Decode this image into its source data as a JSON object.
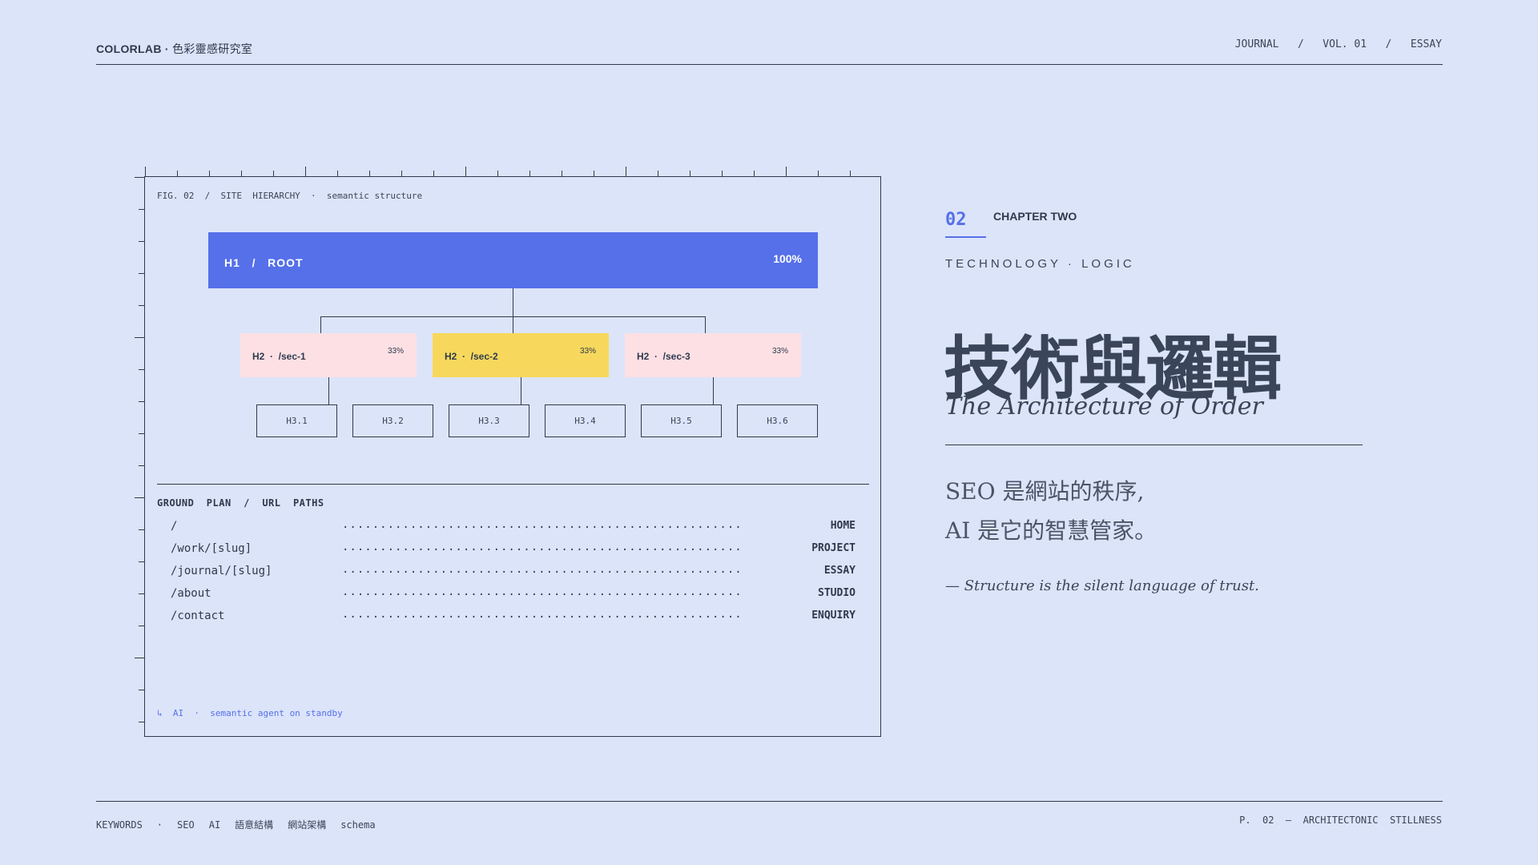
{
  "header": {
    "brand": "COLORLAB",
    "brand_sep": " · ",
    "brand_sub": "色彩靈感研究室",
    "meta": "JOURNAL   /   VOL. 01   /   ESSAY"
  },
  "figure": {
    "caption": "FIG. 02  /  SITE  HIERARCHY  ·  semantic structure",
    "h1": {
      "label": "H1   /   ROOT",
      "pct": "100%"
    },
    "h2": [
      {
        "label": "H2  ·  /sec-1",
        "pct": "33%",
        "color": "#fde0e4"
      },
      {
        "label": "H2  ·  /sec-2",
        "pct": "33%",
        "color": "#f7d85c"
      },
      {
        "label": "H2  ·  /sec-3",
        "pct": "33%",
        "color": "#fde0e4"
      }
    ],
    "h3": [
      "H3.1",
      "H3.2",
      "H3.3",
      "H3.4",
      "H3.5",
      "H3.6"
    ],
    "plan_title": "GROUND  PLAN  /  URL  PATHS",
    "paths": [
      {
        "path": "/",
        "dest": "HOME"
      },
      {
        "path": "/work/[slug]",
        "dest": "PROJECT"
      },
      {
        "path": "/journal/[slug]",
        "dest": "ESSAY"
      },
      {
        "path": "/about",
        "dest": "STUDIO"
      },
      {
        "path": "/contact",
        "dest": "ENQUIRY"
      }
    ],
    "leader_dots": ".....................................................",
    "ai_status": "↳  AI  ·  semantic agent on standby"
  },
  "chapter": {
    "number": "02",
    "label": "CHAPTER TWO",
    "kicker": "TECHNOLOGY · LOGIC",
    "title_zh": "技術與邏輯",
    "title_en": "The Architecture of Order",
    "lead_line1": "SEO 是網站的秩序,",
    "lead_line2": "AI 是它的智慧管家。",
    "quote": "— Structure is the silent language of trust."
  },
  "footer": {
    "keywords": [
      "KEYWORDS",
      "·",
      "SEO",
      "AI",
      "語意結構",
      "網站架構",
      "schema"
    ],
    "page_meta": "P.  02  —  ARCHITECTONIC  STILLNESS"
  },
  "colors": {
    "background": "#dce4fa",
    "accent": "#5570e9",
    "ink": "#2f3a4d",
    "pink": "#fde0e4",
    "yellow": "#f7d85c"
  }
}
